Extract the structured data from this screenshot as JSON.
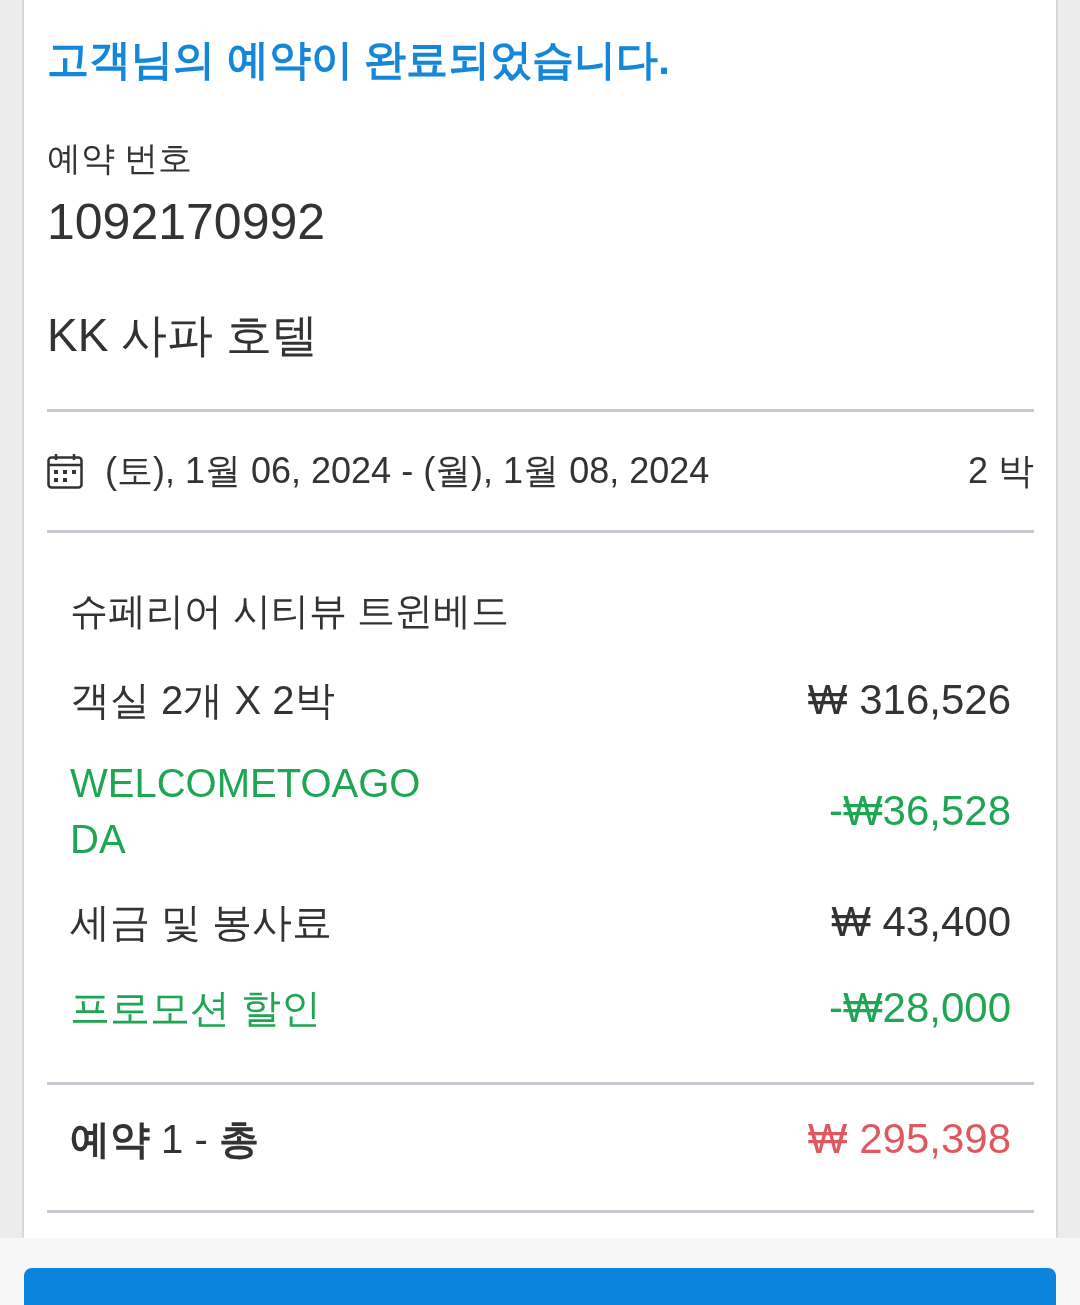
{
  "confirmation": {
    "title": "고객님의 예약이 완료되었습니다."
  },
  "booking": {
    "number_label": "예약 번호",
    "number": "1092170992",
    "hotel_name": "KK 사파 호텔"
  },
  "stay": {
    "dates": "(토), 1월 06, 2024 - (월), 1월 08, 2024",
    "nights": "2 박"
  },
  "room": {
    "name": "슈페리어 시티뷰 트윈베드",
    "lines": [
      {
        "kind": "charge",
        "label": "객실 2개 X 2박",
        "amount": "₩ 316,526"
      },
      {
        "kind": "discount",
        "label": "WELCOMETOAGODA",
        "amount": "-₩36,528"
      },
      {
        "kind": "charge",
        "label": "세금 및 봉사료",
        "amount": "₩ 43,400"
      },
      {
        "kind": "discount",
        "label": "프로모션 할인",
        "amount": "-₩28,000"
      }
    ]
  },
  "total": {
    "label": "**예약** 1 - **총**",
    "amount": "₩ 295,398"
  }
}
